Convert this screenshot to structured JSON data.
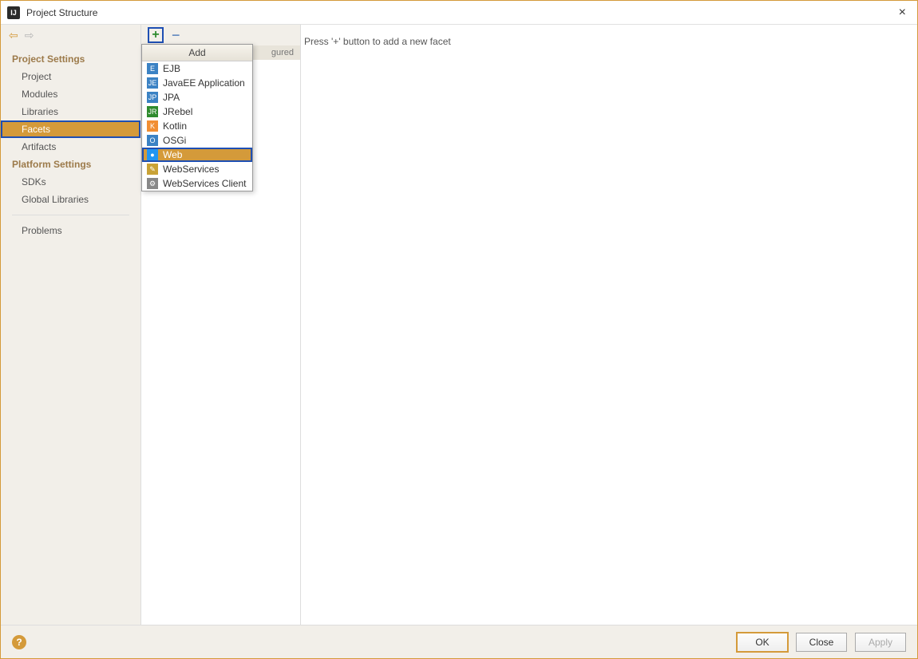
{
  "titlebar": {
    "title": "Project Structure",
    "close": "×"
  },
  "nav": {
    "back": "⇦",
    "fwd": "⇨",
    "section1": "Project Settings",
    "items1": [
      "Project",
      "Modules",
      "Libraries",
      "Facets",
      "Artifacts"
    ],
    "section2": "Platform Settings",
    "items2": [
      "SDKs",
      "Global Libraries"
    ],
    "problems": "Problems"
  },
  "mid": {
    "plus": "+",
    "minus": "−",
    "configured_suffix": "gured",
    "popup_title": "Add",
    "popup_items": [
      {
        "label": "EJB",
        "icon": "ic-ejb",
        "glyph": "E"
      },
      {
        "label": "JavaEE Application",
        "icon": "ic-jee",
        "glyph": "JE"
      },
      {
        "label": "JPA",
        "icon": "ic-jpa",
        "glyph": "JP"
      },
      {
        "label": "JRebel",
        "icon": "ic-jr",
        "glyph": "JR"
      },
      {
        "label": "Kotlin",
        "icon": "ic-kt",
        "glyph": "K"
      },
      {
        "label": "OSGi",
        "icon": "ic-osgi",
        "glyph": "O"
      },
      {
        "label": "Web",
        "icon": "ic-web",
        "glyph": "●"
      },
      {
        "label": "WebServices",
        "icon": "ic-ws",
        "glyph": "✎"
      },
      {
        "label": "WebServices Client",
        "icon": "ic-wsc",
        "glyph": "⚙"
      }
    ],
    "selected_popup": "Web"
  },
  "right": {
    "hint": "Press '+' button to add a new facet"
  },
  "footer": {
    "help": "?",
    "ok": "OK",
    "close": "Close",
    "apply": "Apply"
  },
  "selected_sidebar": "Facets"
}
